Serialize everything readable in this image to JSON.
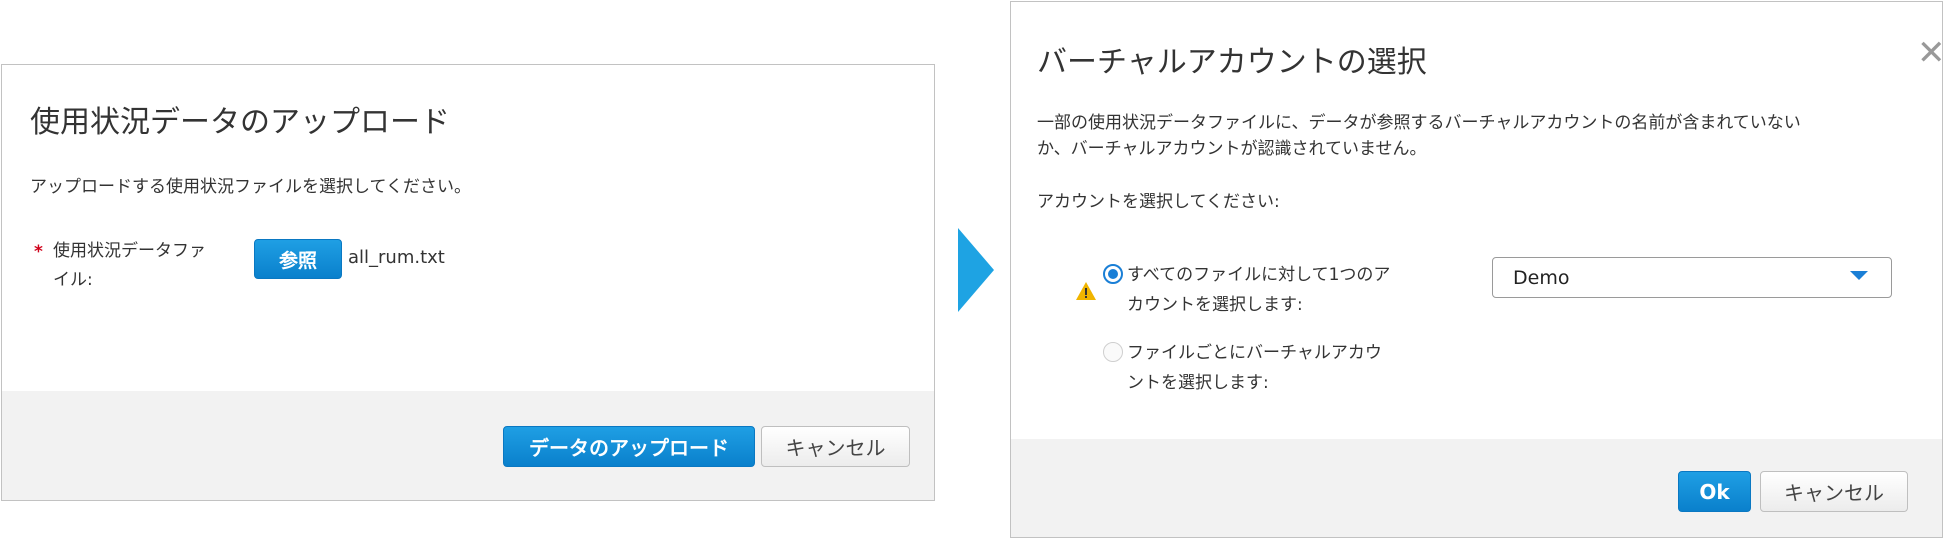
{
  "upload_dialog": {
    "title": "使用状況データのアップロード",
    "instruction": "アップロードする使用状況ファイルを選択してください。",
    "required_marker": "*",
    "field_label_line1": "使用状況データファ",
    "field_label_line2": "イル:",
    "browse_label": "参照",
    "file_name": "all_rum.txt",
    "upload_button": "データのアップロード",
    "cancel_button": "キャンセル"
  },
  "account_dialog": {
    "title": "バーチャルアカウントの選択",
    "close_glyph": "✕",
    "description_line1": "一部の使用状況データファイルに、データが参照するバーチャルアカウントの名前が含まれていない",
    "description_line2": "か、バーチャルアカウントが認識されていません。",
    "prompt": "アカウントを選択してください:",
    "option_all_line1": "すべてのファイルに対して1つのア",
    "option_all_line2": "カウントを選択します:",
    "option_per_file_line1": "ファイルごとにバーチャルアカウ",
    "option_per_file_line2": "ントを選択します:",
    "selected_option": "all",
    "account_select_value": "Demo",
    "ok_button": "Ok",
    "cancel_button": "キャンセル"
  },
  "icons": {
    "arrow": "chevron-right-arrow",
    "warning": "warning-triangle-icon",
    "close": "close-icon",
    "dropdown": "caret-down-icon"
  },
  "colors": {
    "primary_button": "#0a80cc",
    "arrow": "#1ea3e3",
    "radio_selected": "#1a7fd6",
    "warning": "#f0b400",
    "required": "#d0021b",
    "footer_bg": "#f2f2f2"
  }
}
